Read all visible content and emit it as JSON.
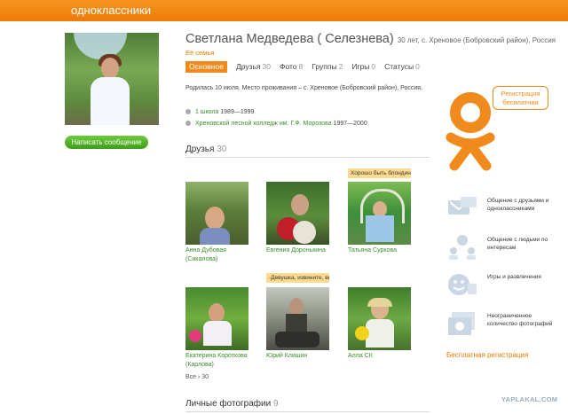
{
  "header": {
    "logo": "одноклассники"
  },
  "profile": {
    "name": "Светлана Медведева ( Селезнева)",
    "details": "30 лет, с. Хреновое (Бобровский район), Россия",
    "family_link": "Её семья",
    "send_message": "Написать сообщение"
  },
  "tabs": [
    {
      "label": "Основное",
      "count": ""
    },
    {
      "label": "Друзья",
      "count": "30"
    },
    {
      "label": "Фото",
      "count": "8"
    },
    {
      "label": "Группы",
      "count": "2"
    },
    {
      "label": "Игры",
      "count": "0"
    },
    {
      "label": "Статусы",
      "count": "0"
    }
  ],
  "bio": "Родилась 10 июля. Место проживания – с. Хреновое (Бобровский район), Россия.",
  "education": [
    {
      "link": "1 школа",
      "years": "1989—1999"
    },
    {
      "link": "Хреновской лесной колледж им. Г.Ф. Морозова",
      "years": "1997—2000"
    }
  ],
  "friends": {
    "title": "Друзья",
    "count": "30",
    "items": [
      {
        "name": "Анна Дубовая (Сикалова)",
        "tooltip": ""
      },
      {
        "name": "Евгения Доронькина",
        "tooltip": ""
      },
      {
        "name": "Татьяна Суркова",
        "tooltip": "Хорошо быть блондин"
      },
      {
        "name": "Екатерина Короткова (Карлова)",
        "tooltip": ""
      },
      {
        "name": "Юрий Клишин",
        "tooltip": "-Девушка, извините, вы"
      },
      {
        "name": "Алла СК",
        "tooltip": ""
      }
    ],
    "all_link": "Все › 30"
  },
  "photos": {
    "title": "Личные фотографии",
    "count": "9"
  },
  "promo": {
    "bubble": "Регистрация бесплатная",
    "features": [
      "Общение с друзьями и одноклассниками",
      "Общение с людьми по интересам",
      "Игры и развлечения",
      "Неограниченное количество фотографий"
    ],
    "free_reg": "Бесплатная регистрация"
  },
  "watermark": "YAPLAKAL.COM",
  "colors": {
    "brand_orange": "#f08a1c",
    "link_green": "#3a8f2a",
    "button_green": "#4fb022"
  }
}
